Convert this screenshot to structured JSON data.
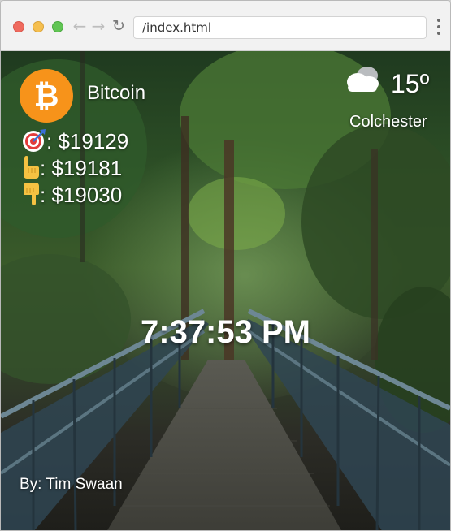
{
  "browser": {
    "address": "/index.html"
  },
  "crypto": {
    "coin_name": "Bitcoin",
    "current_price": ": $19129",
    "high_price": ": $19181",
    "low_price": ": $19030"
  },
  "weather": {
    "temperature": "15º",
    "city": "Colchester"
  },
  "clock": {
    "time": "7:37:53 PM"
  },
  "footer": {
    "author": "By: Tim Swaan"
  },
  "icons": {
    "coin": "bitcoin-icon",
    "current": "target-icon",
    "high": "pointing-up-icon",
    "low": "pointing-down-icon",
    "weather": "cloudy-icon"
  },
  "colors": {
    "bitcoin_orange": "#f7931a",
    "text": "#ffffff"
  }
}
